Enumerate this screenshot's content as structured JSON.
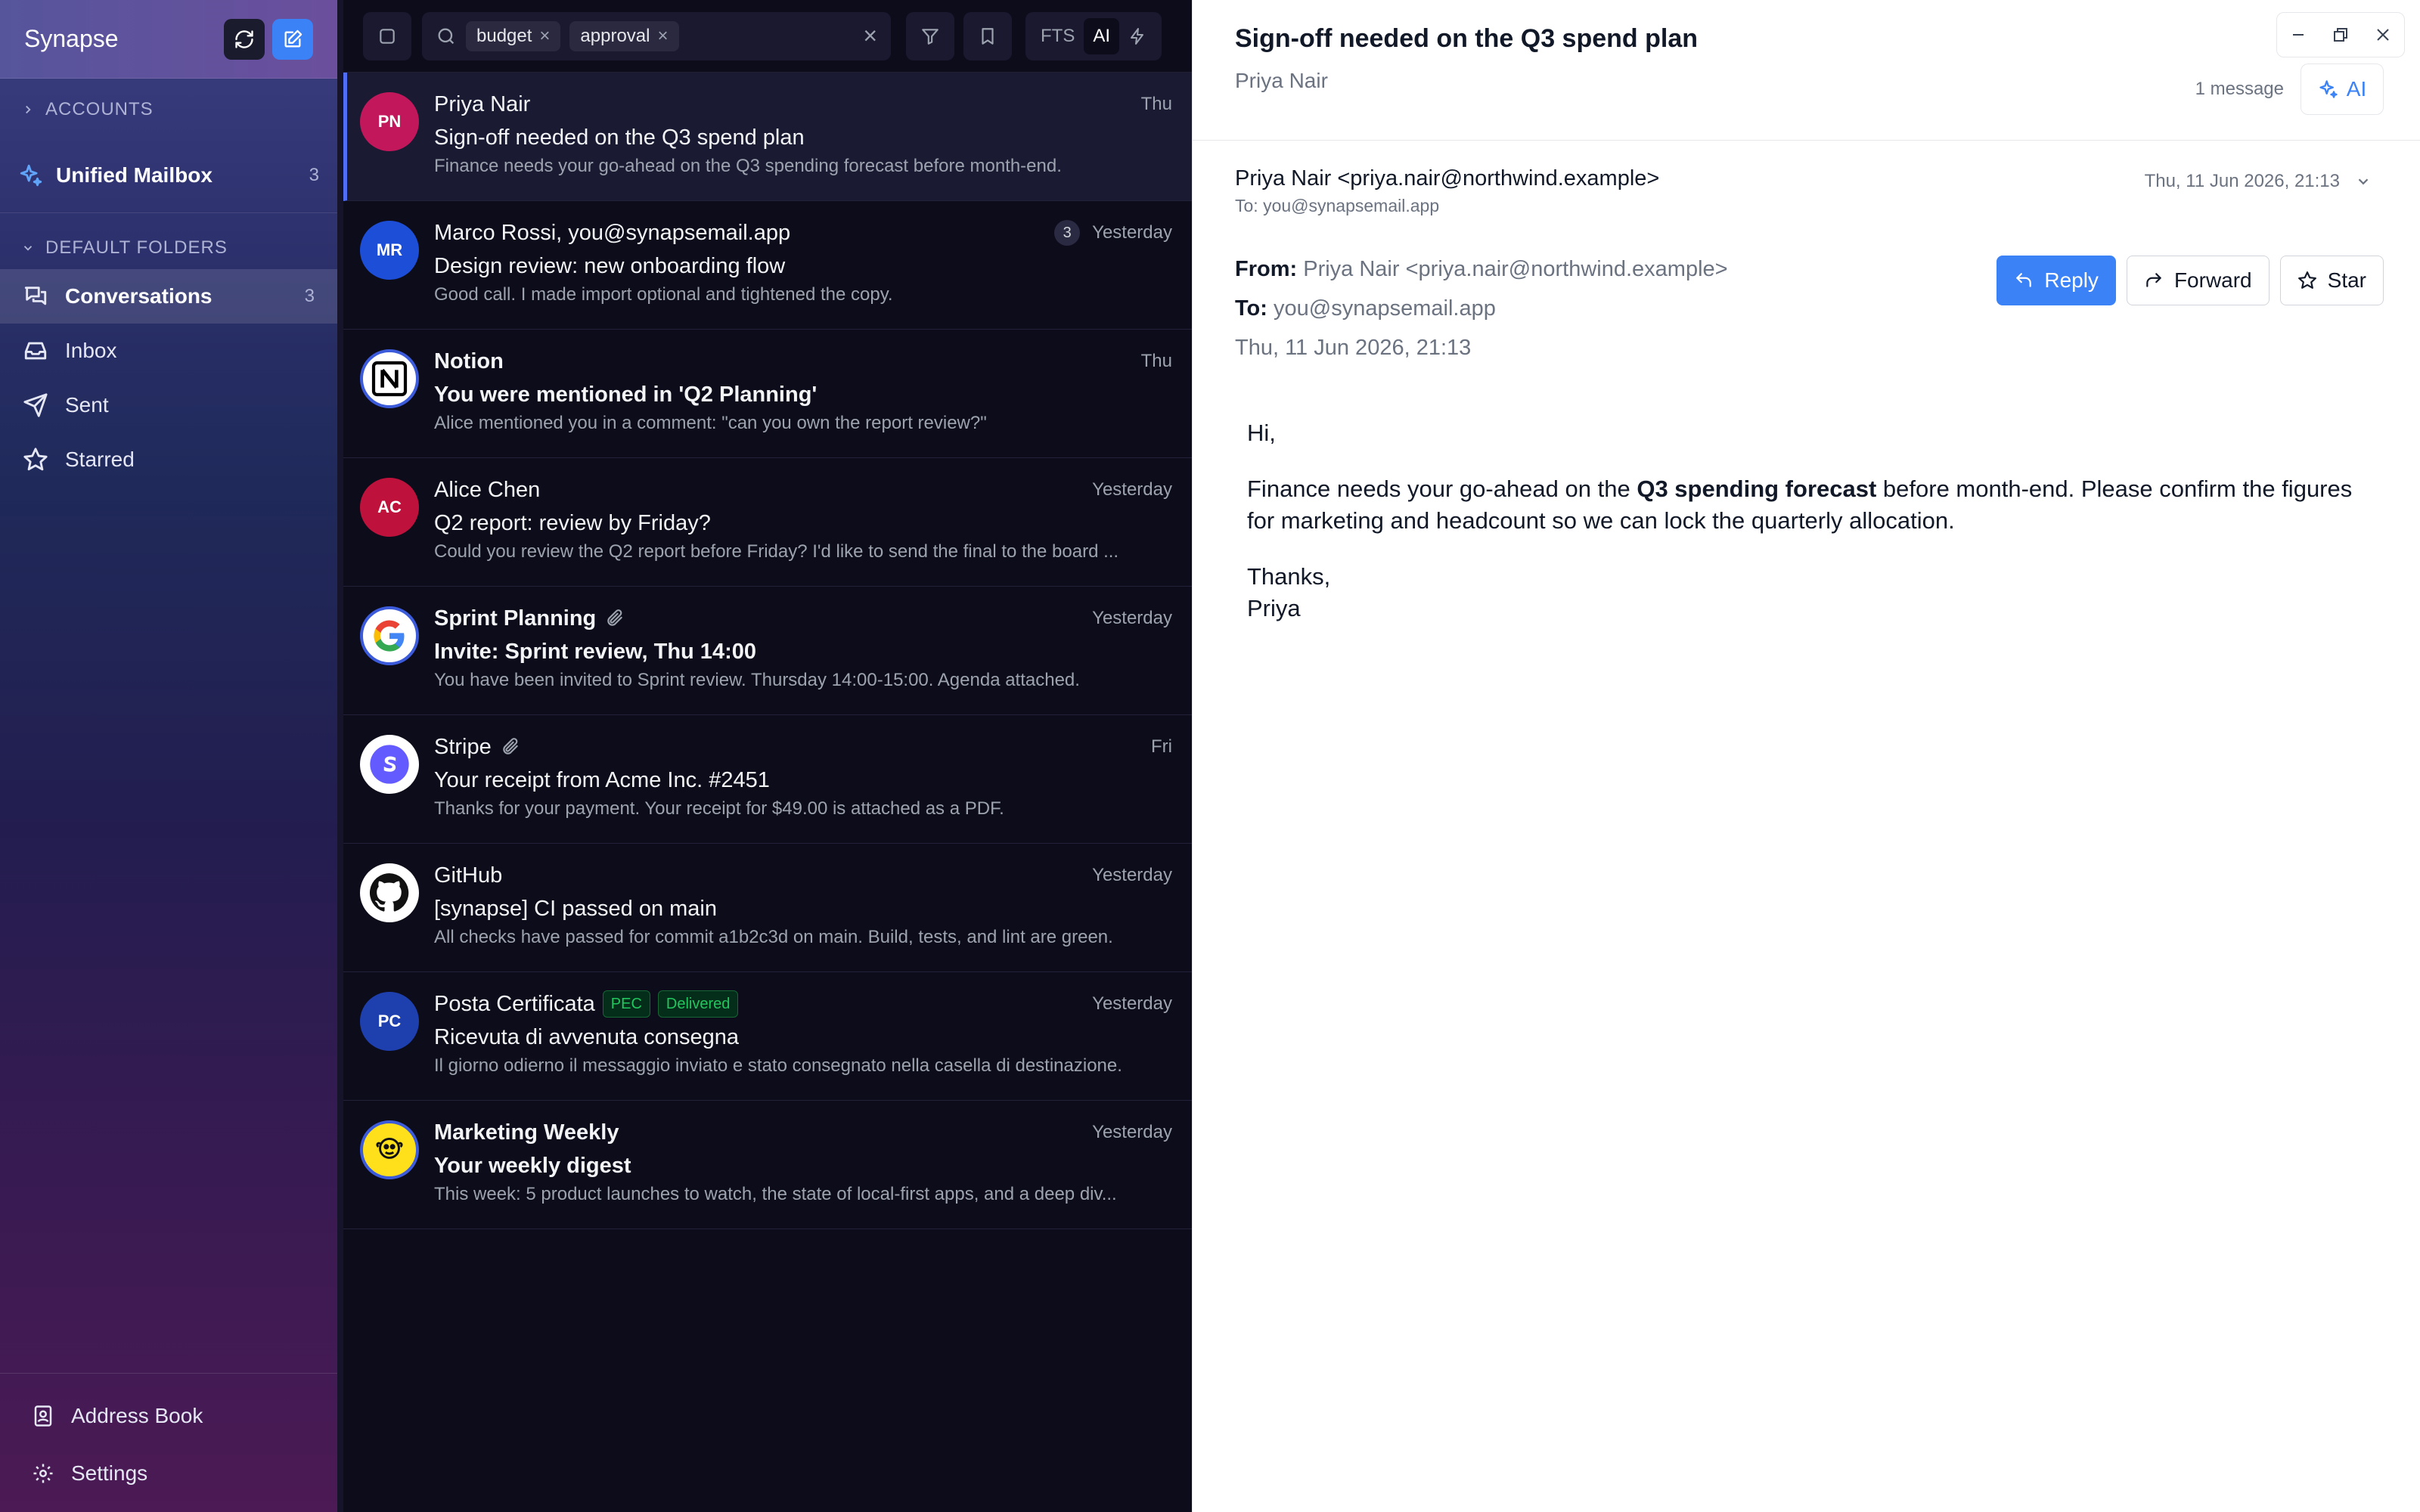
{
  "app": {
    "name": "Synapse"
  },
  "sidebar": {
    "accounts_label": "ACCOUNTS",
    "unified": {
      "label": "Unified Mailbox",
      "count": "3"
    },
    "default_folders_label": "DEFAULT FOLDERS",
    "folders": [
      {
        "label": "Conversations",
        "count": "3",
        "icon": "chat-bubbles-icon"
      },
      {
        "label": "Inbox",
        "count": "",
        "icon": "inbox-icon"
      },
      {
        "label": "Sent",
        "count": "",
        "icon": "send-icon"
      },
      {
        "label": "Starred",
        "count": "",
        "icon": "star-icon"
      }
    ],
    "bottom": [
      {
        "label": "Address Book",
        "icon": "address-book-icon"
      },
      {
        "label": "Settings",
        "icon": "gear-icon"
      }
    ]
  },
  "search": {
    "chips": [
      "budget",
      "approval"
    ],
    "modes": [
      "FTS",
      "AI"
    ],
    "active_mode": "AI"
  },
  "messages": [
    {
      "initials": "PN",
      "avatar_color": "#c2185b",
      "sender": "Priya Nair",
      "subject": "Sign-off needed on the Q3 spend plan",
      "snippet": "Finance needs your go-ahead on the Q3 spending forecast before month-end.",
      "date": "Thu",
      "unread": false,
      "selected": true
    },
    {
      "initials": "MR",
      "avatar_color": "#1d4ed8",
      "sender": "Marco Rossi, you@synapsemail.app",
      "subject": "Design review: new onboarding flow",
      "snippet": "Good call. I made import optional and tightened the copy.",
      "date": "Yesterday",
      "thread_count": "3"
    },
    {
      "logo": "notion",
      "sender": "Notion",
      "subject": "You were mentioned in 'Q2 Planning'",
      "snippet": "Alice mentioned you in a comment: \"can you own the report review?\"",
      "date": "Thu",
      "unread": true
    },
    {
      "initials": "AC",
      "avatar_color": "#be123c",
      "sender": "Alice Chen",
      "subject": "Q2 report: review by Friday?",
      "snippet": "Could you review the Q2 report before Friday? I'd like to send the final to the board ...",
      "date": "Yesterday"
    },
    {
      "logo": "google",
      "sender": "Sprint Planning",
      "subject": "Invite: Sprint review, Thu 14:00",
      "snippet": "You have been invited to Sprint review. Thursday 14:00-15:00. Agenda attached.",
      "date": "Yesterday",
      "unread": true,
      "attachment": true
    },
    {
      "logo": "stripe",
      "sender": "Stripe",
      "subject": "Your receipt from Acme Inc. #2451",
      "snippet": "Thanks for your payment. Your receipt for $49.00 is attached as a PDF.",
      "date": "Fri",
      "attachment": true
    },
    {
      "logo": "github",
      "sender": "GitHub",
      "subject": "[synapse] CI passed on main",
      "snippet": "All checks have passed for commit a1b2c3d on main. Build, tests, and lint are green.",
      "date": "Yesterday"
    },
    {
      "initials": "PC",
      "avatar_color": "#1e40af",
      "sender": "Posta Certificata",
      "subject": "Ricevuta di avvenuta consegna",
      "snippet": "Il giorno odierno il messaggio inviato e stato consegnato nella casella di destinazione.",
      "date": "Yesterday",
      "tags": [
        "PEC",
        "Delivered"
      ]
    },
    {
      "logo": "mailchimp",
      "sender": "Marketing Weekly",
      "subject": "Your weekly digest",
      "snippet": "This week: 5 product launches to watch, the state of local-first apps, and a deep div...",
      "date": "Yesterday",
      "unread": true
    }
  ],
  "reader": {
    "title": "Sign-off needed on the Q3 spend plan",
    "participants": "Priya Nair",
    "message_count": "1 message",
    "ai_label": "AI",
    "header_from": "Priya Nair <priya.nair@northwind.example>",
    "header_to": "To: you@synapsemail.app",
    "header_date": "Thu, 11 Jun 2026, 21:13",
    "from_label": "From:",
    "from_value": "Priya Nair <priya.nair@northwind.example>",
    "to_label": "To:",
    "to_value": "you@synapsemail.app",
    "date_value": "Thu, 11 Jun 2026, 21:13",
    "actions": {
      "reply": "Reply",
      "forward": "Forward",
      "star": "Star"
    },
    "body": {
      "greeting": "Hi,",
      "p1_before": "Finance needs your go-ahead on the ",
      "p1_bold": "Q3 spending forecast",
      "p1_after": " before month-end. Please confirm the figures for marketing and headcount so we can lock the quarterly allocation.",
      "signoff": "Thanks,",
      "name": "Priya"
    }
  }
}
